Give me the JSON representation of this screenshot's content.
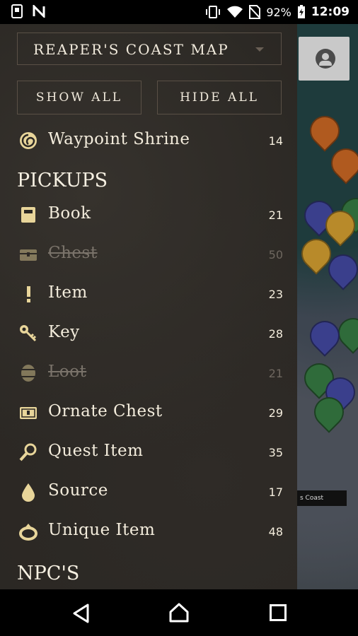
{
  "status_bar": {
    "battery": "92%",
    "time": "12:09",
    "icons": [
      "phone-icon",
      "n-icon",
      "vibrate-icon",
      "wifi-icon",
      "no-sim-icon",
      "battery-charging-icon"
    ]
  },
  "drawer": {
    "map_select": {
      "selected": "REAPER'S COAST MAP"
    },
    "show_all": "SHOW ALL",
    "hide_all": "HIDE ALL",
    "top_items": [
      {
        "name": "Waypoint Shrine",
        "count": "14",
        "icon": "waypoint-swirl-icon",
        "enabled": true
      }
    ],
    "sections": [
      {
        "title": "PICKUPS",
        "items": [
          {
            "name": "Book",
            "count": "21",
            "icon": "book-icon",
            "enabled": true
          },
          {
            "name": "Chest",
            "count": "50",
            "icon": "chest-icon",
            "enabled": false
          },
          {
            "name": "Item",
            "count": "23",
            "icon": "exclamation-icon",
            "enabled": true
          },
          {
            "name": "Key",
            "count": "28",
            "icon": "key-icon",
            "enabled": true
          },
          {
            "name": "Loot",
            "count": "21",
            "icon": "barrel-icon",
            "enabled": false
          },
          {
            "name": "Ornate Chest",
            "count": "29",
            "icon": "ornate-chest-icon",
            "enabled": true
          },
          {
            "name": "Quest Item",
            "count": "35",
            "icon": "magnifier-icon",
            "enabled": true
          },
          {
            "name": "Source",
            "count": "17",
            "icon": "droplet-icon",
            "enabled": true
          },
          {
            "name": "Unique Item",
            "count": "48",
            "icon": "ring-icon",
            "enabled": true
          }
        ]
      },
      {
        "title": "NPC'S",
        "items": []
      }
    ]
  },
  "map": {
    "region_label": "s Coast",
    "profile_icon": "account-icon"
  },
  "colors": {
    "drawer_bg": "#2a2723",
    "text": "#f3ecdc",
    "disabled_text": "#7a736a",
    "icon_gold": "#e8d59a"
  }
}
